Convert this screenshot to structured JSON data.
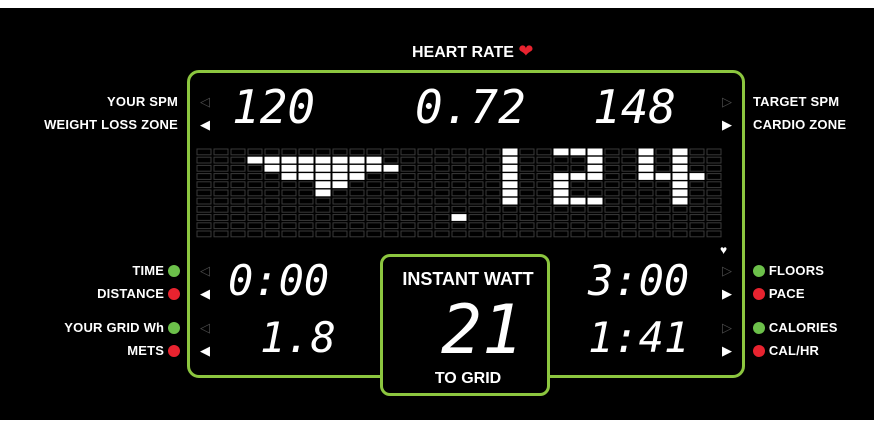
{
  "header": {
    "title": "HEART RATE",
    "heart_icon": "heart-icon"
  },
  "left_labels": {
    "your_spm": "YOUR SPM",
    "weight_loss_zone": "WEIGHT LOSS ZONE",
    "time": "TIME",
    "distance": "DISTANCE",
    "your_grid_wh": "YOUR GRID Wh",
    "mets": "METS"
  },
  "right_labels": {
    "target_spm": "TARGET SPM",
    "cardio_zone": "CARDIO ZONE",
    "floors": "FLOORS",
    "pace": "PACE",
    "calories": "CALORIES",
    "cal_hr": "CAL/HR"
  },
  "top_readouts": {
    "your_spm": "120",
    "middle": "0.72",
    "target_spm": "148"
  },
  "matrix_readout": "124",
  "left_readouts": {
    "time": "0:00",
    "grid_wh": "1.8"
  },
  "right_readouts": {
    "floors": "3:00",
    "calories": "1:41"
  },
  "center": {
    "title": "INSTANT WATT",
    "value": "21",
    "subtitle": "TO GRID"
  },
  "colors": {
    "panel_border": "#8cc63f",
    "green_indicator": "#6cc04a",
    "red_indicator": "#e8232f",
    "heart": "#e8232f"
  }
}
